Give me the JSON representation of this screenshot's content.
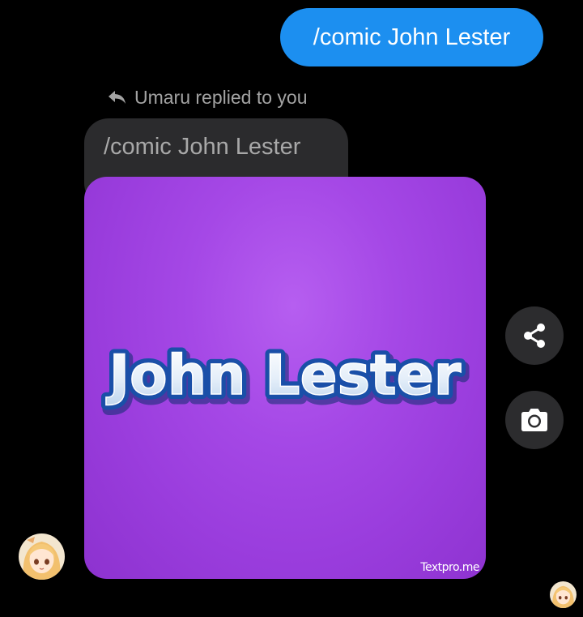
{
  "conversation": {
    "sent_message": "/comic John Lester",
    "reply_header": "Umaru replied to you",
    "quoted_message": "/comic John Lester",
    "image": {
      "text": "John Lester",
      "watermark": "Textpro.me",
      "background_color": "#a548e6"
    }
  },
  "actions": {
    "share_icon": "share-icon",
    "camera_icon": "camera-icon"
  },
  "colors": {
    "sent_bubble": "#1c8ff0",
    "quoted_bubble": "#2b2b2d",
    "action_button": "#2c2c2e"
  }
}
